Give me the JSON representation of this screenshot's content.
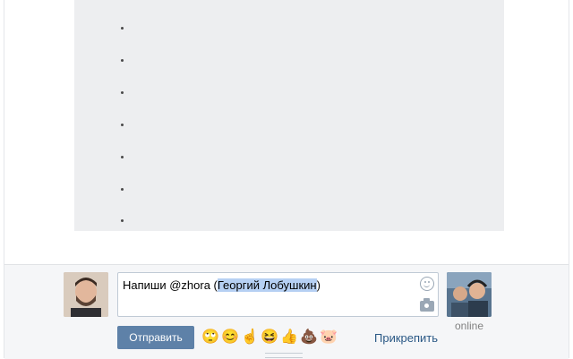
{
  "thread": {
    "placeholder_rows": 7
  },
  "composer": {
    "input_prefix": "Напиши @zhora (",
    "input_mention": "Георгий Лобушкин",
    "input_suffix": ")",
    "send_label": "Отправить",
    "attach_label": "Прикрепить",
    "peer_status": "online",
    "emoji": [
      "🙄",
      "😊",
      "☝️",
      "😆",
      "👍",
      "💩",
      "🐷"
    ],
    "colors": {
      "send_button": "#5e81a8",
      "link": "#2a5885",
      "panel": "#edeef0",
      "mention_highlight": "#b6d0f3"
    }
  },
  "icons": {
    "smile": "smile-icon",
    "camera": "camera-icon"
  }
}
